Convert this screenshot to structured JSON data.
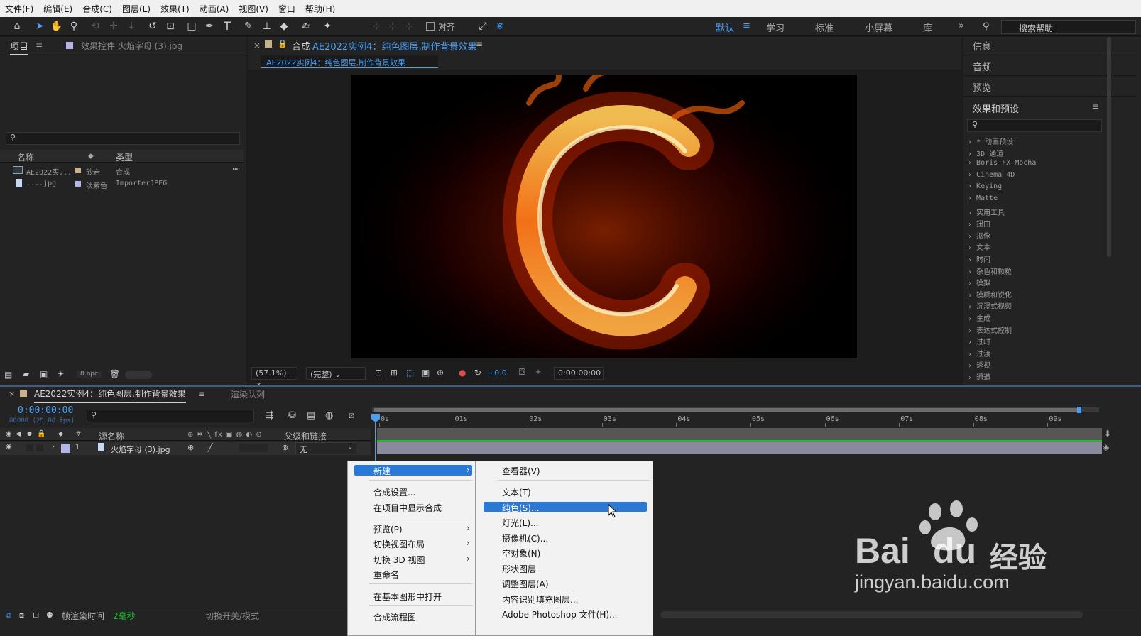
{
  "menubar": [
    "文件(F)",
    "编辑(E)",
    "合成(C)",
    "图层(L)",
    "效果(T)",
    "动画(A)",
    "视图(V)",
    "窗口",
    "帮助(H)"
  ],
  "toolbar": {
    "align_label": "对齐",
    "workspaces": [
      "默认",
      "学习",
      "标准",
      "小屏幕",
      "库"
    ],
    "search_help": "搜索帮助"
  },
  "project": {
    "tab": "项目",
    "effect_controls_tab": "效果控件 火焰字母 (3).jpg",
    "columns": {
      "name": "名称",
      "type": "类型"
    },
    "items": [
      {
        "name": "AE2022实...",
        "label": "砂岩",
        "type": "合成",
        "label_color": "#c9b38a"
      },
      {
        "name": "....jpg",
        "label": "淡紫色",
        "type": "ImporterJPEG",
        "label_color": "#b4b4e6"
      }
    ],
    "bpc": "8 bpc"
  },
  "comp": {
    "title_prefix": "合成",
    "title_name": "AE2022实例4：纯色图层,制作背景效果",
    "subtab": "AE2022实例4：纯色图层,制作背景效果",
    "zoom": "(57.1%)",
    "quality": "(完整)",
    "exposure": "+0.0",
    "timecode": "0:00:00:00",
    "viewer_letter": "C"
  },
  "right_panels": {
    "info": "信息",
    "audio": "音频",
    "preview": "预览",
    "effects_presets": "效果和预设",
    "effects": [
      "* 动画预设",
      "3D 通道",
      "Boris FX Mocha",
      "Cinema 4D",
      "Keying",
      "Matte",
      "实用工具",
      "扭曲",
      "抠像",
      "文本",
      "时间",
      "杂色和颗粒",
      "模拟",
      "模糊和锐化",
      "沉浸式视频",
      "生成",
      "表达式控制",
      "过时",
      "过渡",
      "透视",
      "通道"
    ]
  },
  "timeline": {
    "comp_tab": "AE2022实例4：纯色图层,制作背景效果",
    "render_queue_tab": "渲染队列",
    "timecode": "0:00:00:00",
    "frames": "00000 (25.00 fps)",
    "ruler": [
      "0s",
      "01s",
      "02s",
      "03s",
      "04s",
      "05s",
      "06s",
      "07s",
      "08s",
      "09s"
    ],
    "columns": {
      "num": "#",
      "source": "源名称",
      "parent": "父级和链接"
    },
    "layer": {
      "index": "1",
      "name": "火焰字母 (3).jpg",
      "parent": "无"
    },
    "status": {
      "frame_render_label": "帧渲染时间",
      "frame_render_value": "2毫秒",
      "switches": "切换开关/模式"
    }
  },
  "context_menu": {
    "items": [
      "新建",
      "合成设置...",
      "在项目中显示合成",
      "预览(P)",
      "切换视图布局",
      "切换 3D 视图",
      "重命名",
      "在基本图形中打开",
      "合成流程图"
    ],
    "submenu": [
      "查看器(V)",
      "文本(T)",
      "纯色(S)...",
      "灯光(L)...",
      "摄像机(C)...",
      "空对象(N)",
      "形状图层",
      "调整图层(A)",
      "内容识别填充图层...",
      "Adobe Photoshop 文件(H)..."
    ]
  },
  "watermark": {
    "brand": "Bai",
    "brand2": "du",
    "cn": "经验",
    "url": "jingyan.baidu.com"
  }
}
